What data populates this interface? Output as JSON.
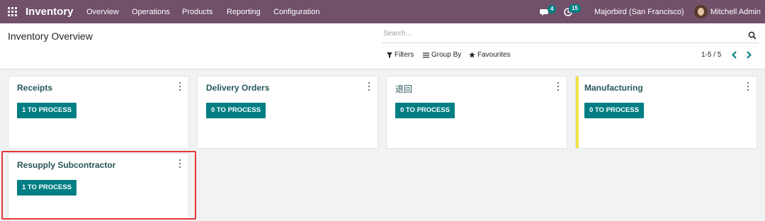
{
  "navbar": {
    "app_name": "Inventory",
    "menu": [
      "Overview",
      "Operations",
      "Products",
      "Reporting",
      "Configuration"
    ],
    "messages_count": "4",
    "activities_count": "15",
    "company": "Majorbird (San Francisco)",
    "user": "Mitchell Admin",
    "color": "#71506a"
  },
  "control_panel": {
    "title": "Inventory Overview",
    "search_placeholder": "Search...",
    "filters": "Filters",
    "group_by": "Group By",
    "favourites": "Favourites",
    "pager": "1-5 / 5"
  },
  "cards": [
    {
      "title": "Receipts",
      "button": "1 TO PROCESS"
    },
    {
      "title": "Delivery Orders",
      "button": "0 TO PROCESS"
    },
    {
      "title": "退回",
      "button": "0 TO PROCESS"
    },
    {
      "title": "Manufacturing",
      "button": "0 TO PROCESS"
    },
    {
      "title": "Resupply Subcontractor",
      "button": "1 TO PROCESS"
    }
  ],
  "colors": {
    "primary": "#017e84",
    "card_title": "#28565a",
    "manufacturing_accent": "#f1e146",
    "highlight": "#e53935"
  }
}
